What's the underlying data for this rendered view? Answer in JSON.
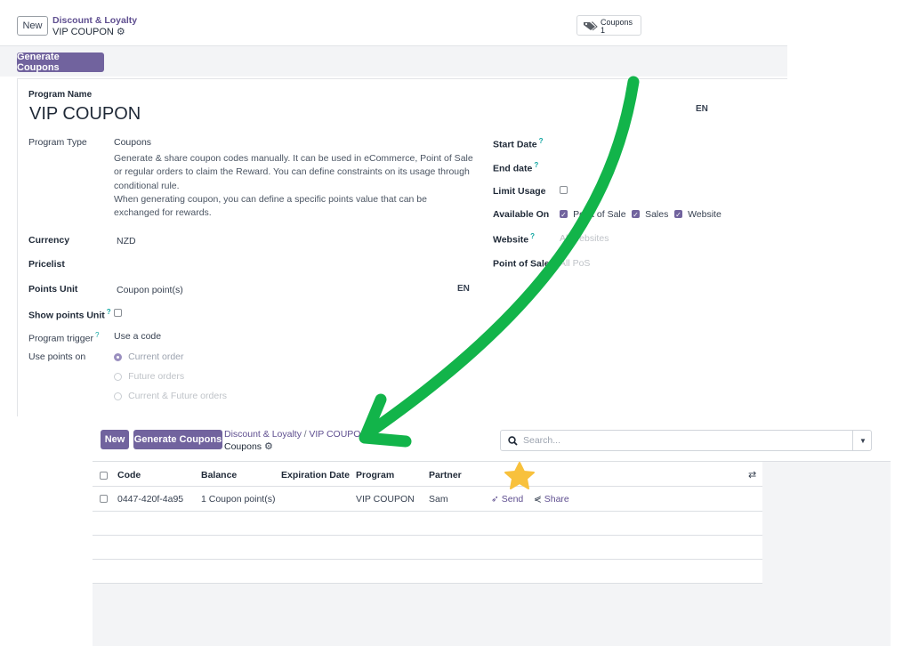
{
  "form": {
    "new_button": "New",
    "breadcrumb_parent": "Discount & Loyalty",
    "breadcrumb_current": "VIP COUPON",
    "smart_button": {
      "label": "Coupons",
      "count": "1"
    },
    "generate_button": "Generate Coupons",
    "program_name_label": "Program Name",
    "program_name": "VIP COUPON",
    "lang_badge": "EN",
    "program_type_label": "Program Type",
    "program_type_value": "Coupons",
    "program_type_desc1": "Generate & share coupon codes manually. It can be used in eCommerce, Point of Sale or regular orders to claim the Reward. You can define constraints on its usage through conditional rule.",
    "program_type_desc2": "When generating coupon, you can define a specific points value that can be exchanged for rewards.",
    "currency_label": "Currency",
    "currency_value": "NZD",
    "pricelist_label": "Pricelist",
    "points_unit_label": "Points Unit",
    "points_unit_value": "Coupon point(s)",
    "points_unit_lang": "EN",
    "show_points_unit_label": "Show points Unit",
    "program_trigger_label": "Program trigger",
    "program_trigger_value": "Use a code",
    "use_points_label": "Use points on",
    "use_points_options": [
      "Current order",
      "Future orders",
      "Current & Future orders"
    ],
    "start_date_label": "Start Date",
    "end_date_label": "End date",
    "limit_usage_label": "Limit Usage",
    "available_on_label": "Available On",
    "available_options": [
      "Point of Sale",
      "Sales",
      "Website"
    ],
    "website_label": "Website",
    "website_placeholder": "All websites",
    "pos_label": "Point of Sale",
    "pos_placeholder": "All PoS"
  },
  "list": {
    "new_button": "New",
    "generate_button": "Generate Coupons",
    "breadcrumb_parent": "Discount & Loyalty",
    "breadcrumb_sep": "/",
    "breadcrumb_mid": "VIP COUPON",
    "breadcrumb_current": "Coupons",
    "search_placeholder": "Search...",
    "columns": [
      "Code",
      "Balance",
      "Expiration Date",
      "Program",
      "Partner"
    ],
    "rows": [
      {
        "code": "0447-420f-4a95",
        "balance": "1 Coupon point(s)",
        "expiration": "",
        "program": "VIP COUPON",
        "partner": "Sam",
        "send": "Send",
        "share": "Share"
      }
    ]
  },
  "colors": {
    "accent": "#71639e",
    "arrow": "#12b44a",
    "star": "#f8c13c"
  }
}
